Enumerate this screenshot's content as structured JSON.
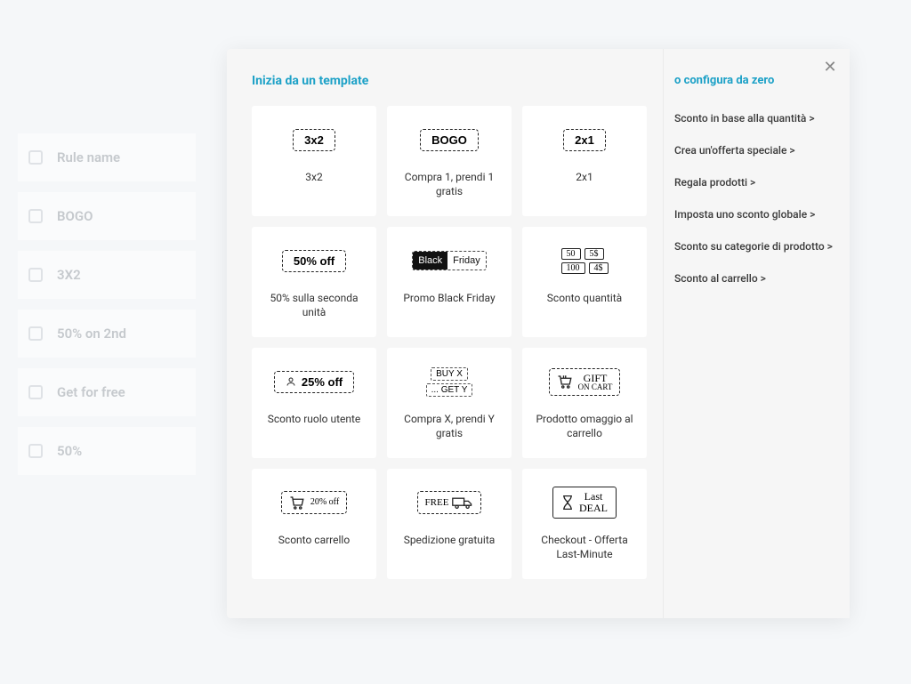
{
  "background": {
    "items": [
      "Rule name",
      "BOGO",
      "3X2",
      "50% on 2nd",
      "Get for free",
      "50%"
    ]
  },
  "modal": {
    "main_heading": "Inizia da un template",
    "side_heading": "o configura da zero",
    "templates": [
      {
        "icon_text": "3x2",
        "label": "3x2"
      },
      {
        "icon_text": "BOGO",
        "label": "Compra 1, prendi 1 gratis"
      },
      {
        "icon_text": "2x1",
        "label": "2x1"
      },
      {
        "icon_text": "50% off",
        "label": "50% sulla seconda unità"
      },
      {
        "icon_black": "Black",
        "icon_white": "Friday",
        "label": "Promo Black Friday"
      },
      {
        "q1a": "50",
        "q1b": "5$",
        "q2a": "100",
        "q2b": "4$",
        "label": "Sconto quantità"
      },
      {
        "icon_text": "25% off",
        "label": "Sconto ruolo utente"
      },
      {
        "line1": "BUY X",
        "line2": "... GET Y",
        "label": "Compra X, prendi Y gratis"
      },
      {
        "gift_a": "GIFT",
        "gift_b": "ON CART",
        "label": "Prodotto omaggio al carrello"
      },
      {
        "pct": "20% off",
        "label": "Sconto carrello"
      },
      {
        "free": "FREE",
        "label": "Spedizione gratuita"
      },
      {
        "line1": "Last",
        "line2": "DEAL",
        "label": "Checkout - Offerta Last-Minute"
      }
    ],
    "side_links": [
      "Sconto in base alla quantità >",
      "Crea un'offerta speciale >",
      "Regala prodotti >",
      "Imposta uno sconto globale >",
      "Sconto su categorie di prodotto >",
      "Sconto al carrello >"
    ]
  }
}
